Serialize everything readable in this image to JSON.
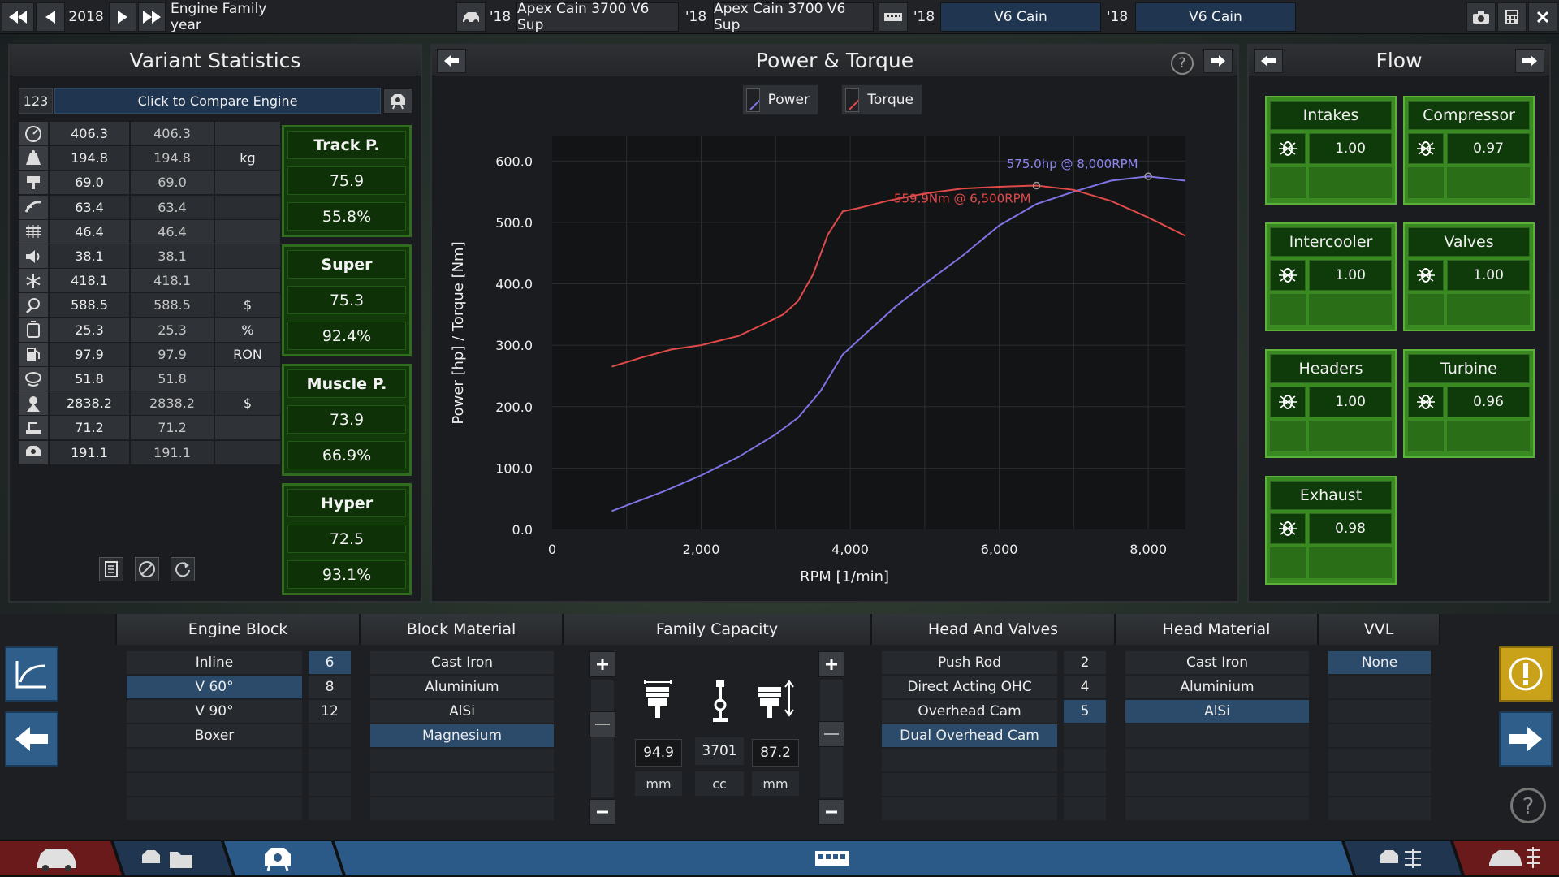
{
  "topbar": {
    "year": "2018",
    "family_label": "Engine Family year",
    "slots": [
      {
        "year": "'18",
        "name": "Apex Cain 3700 V6 Sup"
      },
      {
        "year": "'18",
        "name": "Apex Cain 3700 V6 Sup"
      },
      {
        "year": "'18",
        "name": "V6 Cain"
      },
      {
        "year": "'18",
        "name": "V6 Cain"
      }
    ]
  },
  "variant": {
    "title": "Variant Statistics",
    "id": "123",
    "compare_label": "Click to Compare Engine",
    "rows": [
      {
        "icon": "gauge-icon",
        "v1": "406.3",
        "v2": "406.3",
        "unit": ""
      },
      {
        "icon": "weight-icon",
        "v1": "194.8",
        "v2": "194.8",
        "unit": "kg"
      },
      {
        "icon": "piston-head-icon",
        "v1": "69.0",
        "v2": "69.0",
        "unit": ""
      },
      {
        "icon": "smoothness-icon",
        "v1": "63.4",
        "v2": "63.4",
        "unit": ""
      },
      {
        "icon": "heat-icon",
        "v1": "46.4",
        "v2": "46.4",
        "unit": ""
      },
      {
        "icon": "speaker-icon",
        "v1": "38.1",
        "v2": "38.1",
        "unit": ""
      },
      {
        "icon": "snowflake-icon",
        "v1": "418.1",
        "v2": "418.1",
        "unit": ""
      },
      {
        "icon": "money-wrench-icon",
        "v1": "588.5",
        "v2": "588.5",
        "unit": "$"
      },
      {
        "icon": "fuel-can-icon",
        "v1": "25.3",
        "v2": "25.3",
        "unit": "%"
      },
      {
        "icon": "fuel-pump-icon",
        "v1": "97.9",
        "v2": "97.9",
        "unit": "RON"
      },
      {
        "icon": "emissions-icon",
        "v1": "51.8",
        "v2": "51.8",
        "unit": ""
      },
      {
        "icon": "cost-icon",
        "v1": "2838.2",
        "v2": "2838.2",
        "unit": "$"
      },
      {
        "icon": "production-icon",
        "v1": "71.2",
        "v2": "71.2",
        "unit": ""
      },
      {
        "icon": "engine-icon",
        "v1": "191.1",
        "v2": "191.1",
        "unit": ""
      }
    ],
    "classes": [
      {
        "name": "Track P.",
        "score": "75.9",
        "pct": "55.8%"
      },
      {
        "name": "Super",
        "score": "75.3",
        "pct": "92.4%"
      },
      {
        "name": "Muscle P.",
        "score": "73.9",
        "pct": "66.9%"
      },
      {
        "name": "Hyper",
        "score": "72.5",
        "pct": "93.1%"
      }
    ]
  },
  "chart": {
    "title": "Power & Torque",
    "legend_power": "Power",
    "legend_torque": "Torque",
    "peak_power_label": "575.0hp @ 8,000RPM",
    "peak_torque_label": "559.9Nm @ 6,500RPM",
    "xlabel": "RPM [1/min]",
    "ylabel": "Power [hp] / Torque [Nm]",
    "xticks": [
      "0",
      "2,000",
      "4,000",
      "6,000",
      "8,000"
    ],
    "yticks": [
      "0.0",
      "100.0",
      "200.0",
      "300.0",
      "400.0",
      "500.0",
      "600.0"
    ],
    "power_color": "#7f73e6",
    "torque_color": "#e04a4a"
  },
  "chart_data": {
    "type": "line",
    "xlabel": "RPM [1/min]",
    "ylabel": "Power [hp] / Torque [Nm]",
    "xlim": [
      0,
      8500
    ],
    "ylim": [
      0,
      600
    ],
    "grid": true,
    "legend": "top",
    "series": [
      {
        "name": "Power",
        "x": [
          800,
          1500,
          2000,
          2500,
          3000,
          3300,
          3600,
          3800,
          3900,
          4200,
          4600,
          5000,
          5500,
          6000,
          6500,
          7000,
          7500,
          8000,
          8500
        ],
        "y": [
          30,
          62,
          88,
          118,
          155,
          182,
          225,
          265,
          285,
          318,
          362,
          400,
          445,
          495,
          530,
          550,
          568,
          575,
          568
        ]
      },
      {
        "name": "Torque",
        "x": [
          800,
          1200,
          1600,
          2000,
          2500,
          2800,
          3100,
          3300,
          3500,
          3700,
          3900,
          4100,
          4500,
          5000,
          5500,
          6000,
          6500,
          7000,
          7500,
          8000,
          8500
        ],
        "y": [
          265,
          280,
          293,
          300,
          315,
          332,
          350,
          372,
          415,
          480,
          518,
          523,
          535,
          547,
          555,
          558,
          560,
          553,
          535,
          508,
          478
        ]
      }
    ],
    "annotations": [
      "575.0hp @ 8,000RPM",
      "559.9Nm @ 6,500RPM"
    ]
  },
  "flow": {
    "title": "Flow",
    "items": [
      {
        "name": "Intakes",
        "value": "1.00"
      },
      {
        "name": "Compressor",
        "value": "0.97"
      },
      {
        "name": "Intercooler",
        "value": "1.00"
      },
      {
        "name": "Valves",
        "value": "1.00"
      },
      {
        "name": "Headers",
        "value": "1.00"
      },
      {
        "name": "Turbine",
        "value": "0.96"
      },
      {
        "name": "Exhaust",
        "value": "0.98"
      }
    ]
  },
  "bottom": {
    "engine_block": {
      "title": "Engine Block",
      "layouts": [
        "Inline",
        "V 60°",
        "V 90°",
        "Boxer"
      ],
      "selected_layout": 1,
      "cylinders": [
        "6",
        "8",
        "12"
      ],
      "selected_cyl": 0
    },
    "block_material": {
      "title": "Block Material",
      "items": [
        "Cast Iron",
        "Aluminium",
        "AlSi",
        "Magnesium"
      ],
      "selected": 3
    },
    "family_capacity": {
      "title": "Family Capacity",
      "bore": "94.9",
      "bore_unit": "mm",
      "displacement": "3701",
      "displacement_unit": "cc",
      "stroke": "87.2",
      "stroke_unit": "mm"
    },
    "head_valves": {
      "title": "Head And Valves",
      "items": [
        "Push Rod",
        "Direct Acting OHC",
        "Overhead Cam",
        "Dual Overhead Cam"
      ],
      "selected": 3,
      "valves": [
        "2",
        "4",
        "5"
      ],
      "selected_valve": 2
    },
    "head_material": {
      "title": "Head Material",
      "items": [
        "Cast Iron",
        "Aluminium",
        "AlSi"
      ],
      "selected": 2
    },
    "vvl": {
      "title": "VVL",
      "items": [
        "None"
      ],
      "selected": 0
    }
  },
  "colors": {
    "accent_blue": "#2c4a6a",
    "class_green": "#123a0a",
    "flow_green": "#3a8a22",
    "warning_yellow": "#c9a21a"
  }
}
